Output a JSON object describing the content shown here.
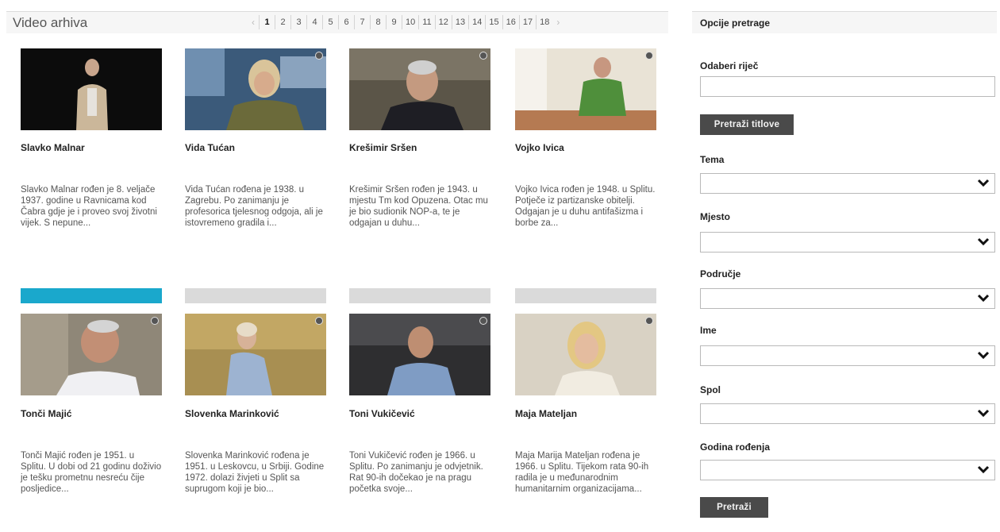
{
  "archive": {
    "title": "Video arhiva",
    "prev": "‹",
    "next": "›",
    "pages": [
      "1",
      "2",
      "3",
      "4",
      "5",
      "6",
      "7",
      "8",
      "9",
      "10",
      "11",
      "12",
      "13",
      "14",
      "15",
      "16",
      "17",
      "18"
    ],
    "current_page": "1"
  },
  "videos": [
    {
      "name": "Slavko Malnar",
      "desc": "Slavko Malnar rođen je 8. veljače 1937. godine u Ravnicama kod Čabra gdje je i proveo svoj životni vijek. S nepune..."
    },
    {
      "name": "Vida Tućan",
      "desc": "Vida Tućan rođena je 1938. u Zagrebu. Po zanimanju je profesorica tjelesnog odgoja, ali je istovremeno gradila i..."
    },
    {
      "name": "Krešimir Sršen",
      "desc": "Krešimir Sršen rođen je 1943. u mjestu Tm kod Opuzena. Otac mu je bio sudionik NOP-a, te je odgajan u duhu..."
    },
    {
      "name": "Vojko Ivica",
      "desc": "Vojko Ivica rođen je 1948. u Splitu. Potječe iz partizanske obitelji. Odgajan je u duhu antifašizma i borbe za..."
    },
    {
      "name": "Tonči Majić",
      "desc": "Tonči Majić rođen je 1951. u Splitu. U dobi od 21 godinu doživio je tešku prometnu nesreću čije posljedice..."
    },
    {
      "name": "Slovenka Marinković",
      "desc": "Slovenka Marinković rođena je 1951. u Leskovcu, u Srbiji. Godine 1972. dolazi živjeti u Split sa suprugom koji je bio..."
    },
    {
      "name": "Toni Vukičević",
      "desc": "Toni Vukičević rođen je 1966. u Splitu. Po zanimanju je odvjetnik. Rat 90-ih dočekao je na pragu početka svoje..."
    },
    {
      "name": "Maja Mateljan",
      "desc": "Maja Marija Mateljan rođena je 1966. u Splitu. Tijekom rata 90-ih radila je u međunarodnim humanitarnim organizacijama..."
    }
  ],
  "sidebar": {
    "title": "Opcije pretrage",
    "word_label": "Odaberi riječ",
    "word_value": "",
    "search_subtitles": "Pretraži titlove",
    "filters": [
      {
        "label": "Tema",
        "value": ""
      },
      {
        "label": "Mjesto",
        "value": ""
      },
      {
        "label": "Područje",
        "value": ""
      },
      {
        "label": "Ime",
        "value": ""
      },
      {
        "label": "Spol",
        "value": ""
      },
      {
        "label": "Godina rođenja",
        "value": ""
      }
    ],
    "search_button": "Pretraži"
  },
  "colors": {
    "accent": "#1aa8cc",
    "button": "#4a4a4a",
    "separator": "#dadada"
  }
}
